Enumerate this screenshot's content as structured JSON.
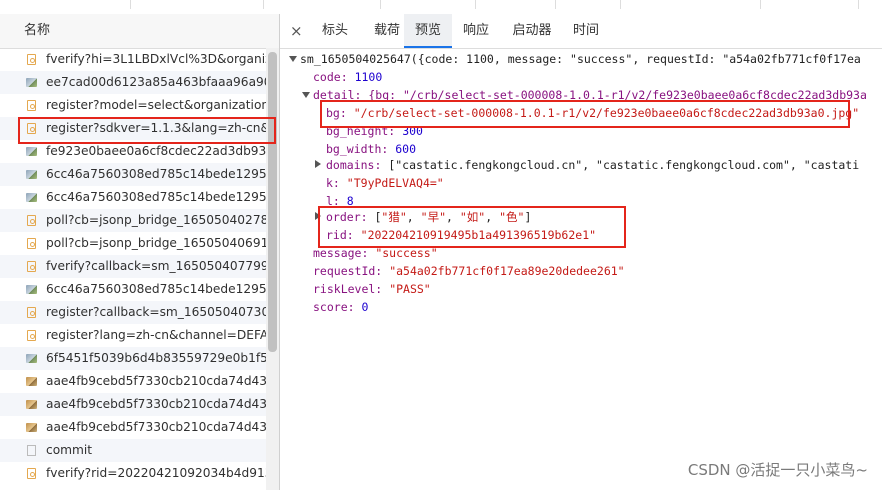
{
  "left": {
    "header": "名称",
    "requests": [
      {
        "name": "fverify?hi=3L1LBDxlVcl%3D&organiz",
        "icon": "script-icon"
      },
      {
        "name": "ee7cad00d6123a85a463bfaaa96a903",
        "icon": "image-icon"
      },
      {
        "name": "register?model=select&organization.",
        "icon": "script-icon"
      },
      {
        "name": "register?sdkver=1.1.3&lang=zh-cn&c",
        "icon": "script-icon"
      },
      {
        "name": "fe923e0baee0a6cf8cdec22ad3db93a.",
        "icon": "image-icon"
      },
      {
        "name": "6cc46a7560308ed785c14bede12956c",
        "icon": "image-icon"
      },
      {
        "name": "6cc46a7560308ed785c14bede12956c",
        "icon": "image-icon"
      },
      {
        "name": "poll?cb=jsonp_bridge_165050402787",
        "icon": "script-icon"
      },
      {
        "name": "poll?cb=jsonp_bridge_165050406914",
        "icon": "script-icon"
      },
      {
        "name": "fverify?callback=sm_1650504077990.",
        "icon": "script-icon"
      },
      {
        "name": "6cc46a7560308ed785c14bede12956c",
        "icon": "image-icon"
      },
      {
        "name": "register?callback=sm_165050407304.",
        "icon": "script-icon"
      },
      {
        "name": "register?lang=zh-cn&channel=DEFA.",
        "icon": "script-icon"
      },
      {
        "name": "6f5451f5039b6d4b83559729e0b1f52.",
        "icon": "image-icon"
      },
      {
        "name": "aae4fb9cebd5f7330cb210cda74d432.",
        "icon": "image-icon-warm"
      },
      {
        "name": "aae4fb9cebd5f7330cb210cda74d432.",
        "icon": "image-icon-warm"
      },
      {
        "name": "aae4fb9cebd5f7330cb210cda74d432.",
        "icon": "image-icon-warm"
      },
      {
        "name": "commit",
        "icon": "blank-icon"
      },
      {
        "name": "fverify?rid=20220421092034b4d913c",
        "icon": "script-icon"
      }
    ],
    "highlighted_index": 3
  },
  "tabs": {
    "close": "×",
    "items": [
      "标头",
      "载荷",
      "预览",
      "响应",
      "启动器",
      "时间"
    ],
    "active": "预览"
  },
  "preview": {
    "root": "sm_1650504025647({code: 1100, message: \"success\", requestId: \"a54a02fb771cf0f17ea",
    "code_key": "code:",
    "code_val": "1100",
    "detail_summary": "detail: {bg: \"/crb/select-set-000008-1.0.1-r1/v2/fe923e0baee0a6cf8cdec22ad3db93a",
    "bg_key": "bg:",
    "bg_val": "\"/crb/select-set-000008-1.0.1-r1/v2/fe923e0baee0a6cf8cdec22ad3db93a0.jpg\"",
    "bg_height_key": "bg_height:",
    "bg_height_val": "300",
    "bg_width_key": "bg_width:",
    "bg_width_val": "600",
    "domains_key": "domains:",
    "domains_val": "[\"castatic.fengkongcloud.cn\", \"castatic.fengkongcloud.com\", \"castati",
    "k_key": "k:",
    "k_val": "\"T9yPdELVAQ4=\"",
    "l_key": "l:",
    "l_val": "8",
    "order_key": "order:",
    "order_open": "[",
    "order_items": [
      "\"猎\"",
      "\"早\"",
      "\"如\"",
      "\"色\""
    ],
    "order_close": "]",
    "rid_key": "rid:",
    "rid_val": "\"202204210919495b1a491396519b62e1\"",
    "message_key": "message:",
    "message_val": "\"success\"",
    "requestId_key": "requestId:",
    "requestId_val": "\"a54a02fb771cf0f17ea89e20dedee261\"",
    "riskLevel_key": "riskLevel:",
    "riskLevel_val": "\"PASS\"",
    "score_key": "score:",
    "score_val": "0"
  },
  "watermark": "CSDN @活捉一只小菜鸟~"
}
